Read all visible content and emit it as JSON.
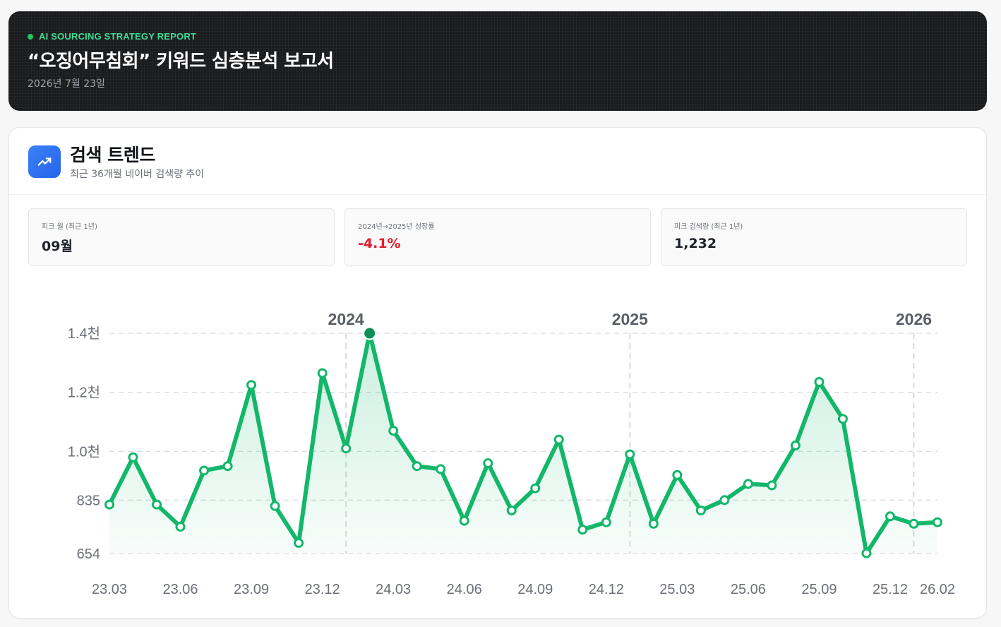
{
  "header": {
    "eyebrow": "AI SOURCING STRATEGY REPORT",
    "title": "“오징어무침회” 키워드 심층분석 보고서",
    "date": "2026년 7월 23일"
  },
  "card": {
    "icon": "trending-up-icon",
    "title": "검색 트렌드",
    "subtitle": "최근 36개월 네이버 검색량 추이"
  },
  "stats": [
    {
      "label": "피크 월 (최근 1년)",
      "value": "09월",
      "negative": false
    },
    {
      "label": "2024년→2025년 성장률",
      "value": "-4.1%",
      "negative": true
    },
    {
      "label": "피크 검색량 (최근 1년)",
      "value": "1,232",
      "negative": false
    }
  ],
  "colors": {
    "line": "#12b76a",
    "peak": "#0e8f55",
    "negative": "#e11d2e",
    "accent": "#3ddc97",
    "icon_bg": "#2563eb"
  },
  "chart_data": {
    "type": "area",
    "x": [
      "23.03",
      "23.04",
      "23.05",
      "23.06",
      "23.07",
      "23.08",
      "23.09",
      "23.10",
      "23.11",
      "23.12",
      "24.01",
      "24.02",
      "24.03",
      "24.04",
      "24.05",
      "24.06",
      "24.07",
      "24.08",
      "24.09",
      "24.10",
      "24.11",
      "24.12",
      "25.01",
      "25.02",
      "25.03",
      "25.04",
      "25.05",
      "25.06",
      "25.07",
      "25.08",
      "25.09",
      "25.10",
      "25.11",
      "25.12",
      "26.01",
      "26.02"
    ],
    "values": [
      820,
      980,
      820,
      745,
      935,
      950,
      1225,
      815,
      690,
      1265,
      1010,
      1400,
      1070,
      950,
      940,
      765,
      960,
      800,
      875,
      1040,
      735,
      760,
      990,
      755,
      920,
      800,
      835,
      890,
      885,
      1020,
      1235,
      1110,
      655,
      780,
      755,
      760
    ],
    "peak_index": 11,
    "x_tick_labels": [
      "23.03",
      "23.06",
      "23.09",
      "23.12",
      "24.03",
      "24.06",
      "24.09",
      "24.12",
      "25.03",
      "25.06",
      "25.09",
      "25.12",
      "26.02"
    ],
    "y_ticks": [
      {
        "value": 654,
        "label": "654"
      },
      {
        "value": 835,
        "label": "835"
      },
      {
        "value": 1000,
        "label": "1.0천"
      },
      {
        "value": 1200,
        "label": "1.2천"
      },
      {
        "value": 1400,
        "label": "1.4천"
      }
    ],
    "ylim": [
      654,
      1400
    ],
    "year_markers": [
      {
        "label": "2024",
        "at": "24.01"
      },
      {
        "label": "2025",
        "at": "25.01"
      },
      {
        "label": "2026",
        "at": "26.01"
      }
    ],
    "grid": true,
    "xlabel": "",
    "ylabel": ""
  }
}
